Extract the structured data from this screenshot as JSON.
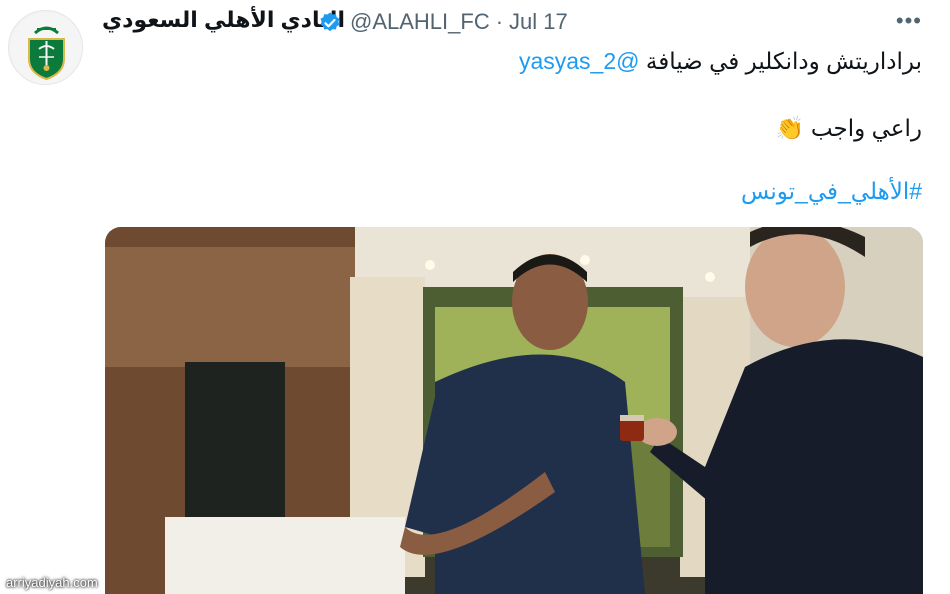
{
  "tweet": {
    "author": {
      "display_name": "النادي الأهلي السعودي",
      "handle": "@ALAHLI_FC",
      "verified": true,
      "avatar_icon": "al-ahli-logo-icon"
    },
    "separator": "·",
    "date": "Jul 17",
    "more_label": "•••",
    "text_lines": [
      {
        "before": "براداريتش ودانكلير في ضيافة ",
        "mention": "@yasyas_2"
      },
      {
        "text": "راعي واجب",
        "emoji": "👏"
      },
      {
        "hashtag": "#الأهلي_في_تونس"
      }
    ]
  },
  "media": {
    "type": "video",
    "scene": "two players sharing tea in a room"
  },
  "watermark": "arriyadiyah.com",
  "colors": {
    "link": "#1d9bf0",
    "muted": "#536471",
    "text": "#0f1419",
    "verified": "#1d9bf0",
    "logo_green": "#0b7a3a"
  }
}
